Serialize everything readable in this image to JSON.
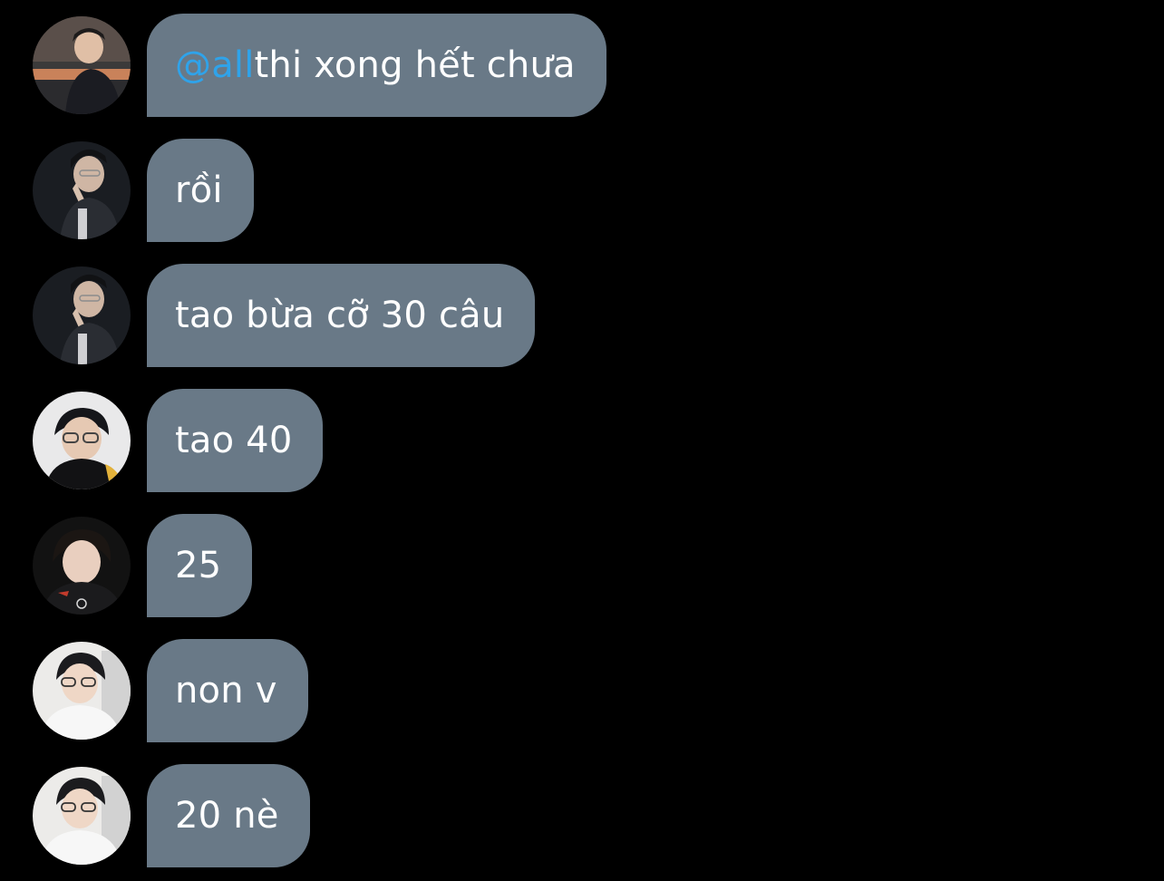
{
  "colors": {
    "background": "#000000",
    "bubble": "#697987",
    "mention": "#2fa3ea",
    "text": "#ffffff"
  },
  "messages": [
    {
      "avatar_icon": "user-avatar-1",
      "mention": "@all",
      "text": " thi xong hết chưa"
    },
    {
      "avatar_icon": "user-avatar-2",
      "text": "rồi"
    },
    {
      "avatar_icon": "user-avatar-2",
      "text": "tao bừa cỡ 30 câu"
    },
    {
      "avatar_icon": "user-avatar-3",
      "text": "tao 40"
    },
    {
      "avatar_icon": "user-avatar-4",
      "text": "25"
    },
    {
      "avatar_icon": "user-avatar-5",
      "text": "non v"
    },
    {
      "avatar_icon": "user-avatar-5",
      "text": "20 nè"
    }
  ]
}
